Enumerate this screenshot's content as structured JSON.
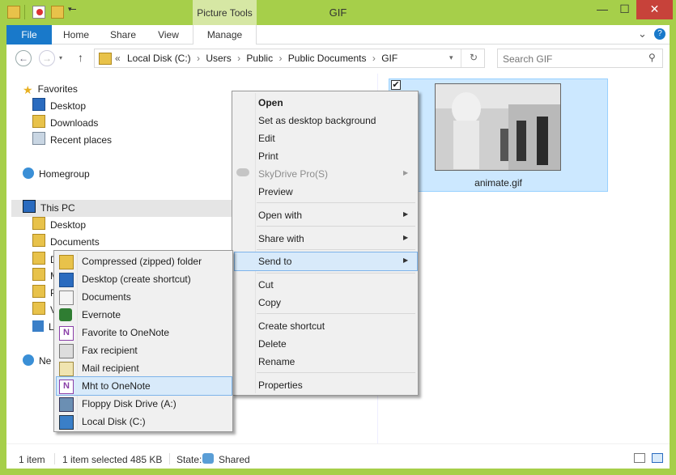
{
  "window": {
    "title": "GIF",
    "context_tab": "Picture Tools",
    "minimize": "—",
    "maximize": "☐",
    "close": "✕",
    "ribbon_collapse": "⌄",
    "help": "?"
  },
  "ribbon": {
    "file": "File",
    "home": "Home",
    "share": "Share",
    "view": "View",
    "manage": "Manage"
  },
  "address": {
    "prefix": "«",
    "crumbs": [
      "Local Disk (C:)",
      "Users",
      "Public",
      "Public Documents",
      "GIF"
    ],
    "separator": "›",
    "search_placeholder": "Search GIF"
  },
  "nav": {
    "favorites": "Favorites",
    "desktop": "Desktop",
    "downloads": "Downloads",
    "recent": "Recent places",
    "homegroup": "Homegroup",
    "thispc": "This PC",
    "pc_desktop": "Desktop",
    "documents": "Documents",
    "d": "D",
    "m": "M",
    "p": "P",
    "v": "V",
    "l": "L",
    "network": "Ne"
  },
  "file": {
    "name": "animate.gif",
    "checked": true
  },
  "context_menu": {
    "open": "Open",
    "set_bg": "Set as desktop background",
    "edit": "Edit",
    "print": "Print",
    "skydrive": "SkyDrive Pro(S)",
    "preview": "Preview",
    "open_with": "Open with",
    "share_with": "Share with",
    "send_to": "Send to",
    "cut": "Cut",
    "copy": "Copy",
    "create_shortcut": "Create shortcut",
    "delete": "Delete",
    "rename": "Rename",
    "properties": "Properties"
  },
  "send_to_menu": {
    "items": [
      "Compressed (zipped) folder",
      "Desktop (create shortcut)",
      "Documents",
      "Evernote",
      "Favorite to OneNote",
      "Fax recipient",
      "Mail recipient",
      "Mht to OneNote",
      "Floppy Disk Drive (A:)",
      "Local Disk (C:)"
    ]
  },
  "status": {
    "count": "1 item",
    "selected": "1 item selected",
    "size": "485 KB",
    "state_label": "State:",
    "state_value": "Shared"
  },
  "colors": {
    "accent_green": "#a6cf4a",
    "file_tab_blue": "#1979ca",
    "selection": "#cce8ff",
    "close_red": "#c7423a"
  }
}
